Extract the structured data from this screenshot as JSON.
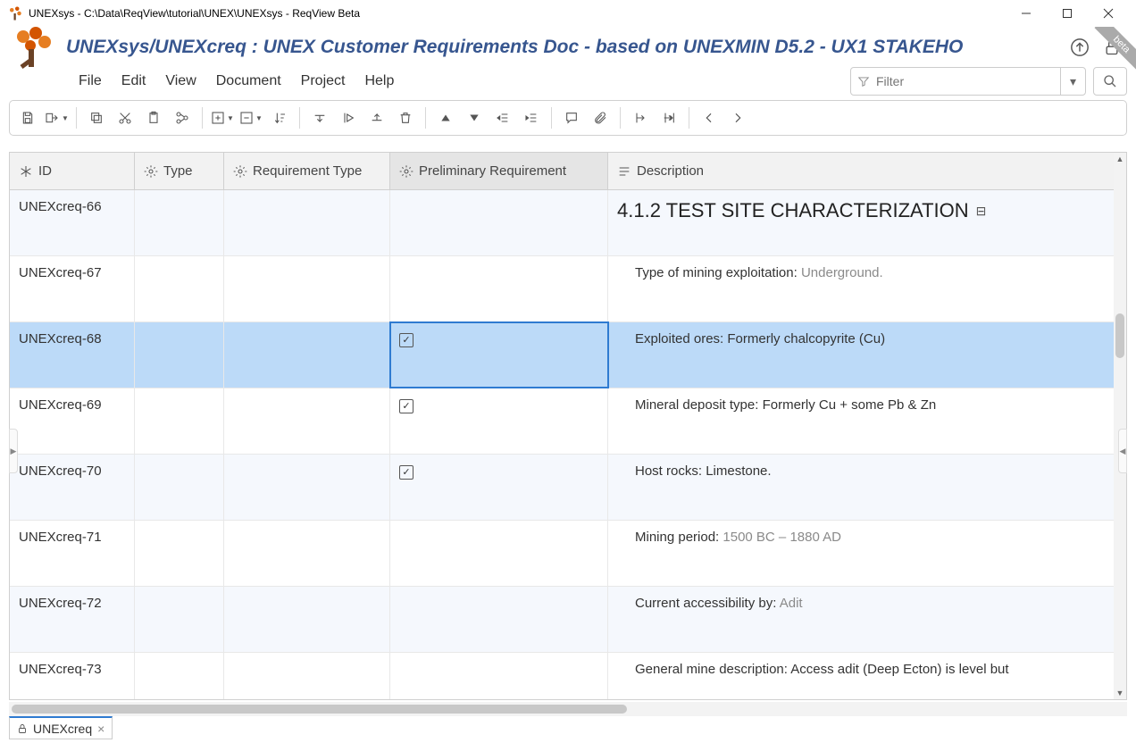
{
  "window": {
    "title": "UNEXsys - C:\\Data\\ReqView\\tutorial\\UNEX\\UNEXsys - ReqView Beta"
  },
  "header": {
    "breadcrumb": "UNEXsys/UNEXcreq : UNEX Customer Requirements Doc - based on UNEXMIN D5.2 - UX1 STAKEHO",
    "beta": "beta"
  },
  "menu": {
    "file": "File",
    "edit": "Edit",
    "view": "View",
    "document": "Document",
    "project": "Project",
    "help": "Help"
  },
  "filter": {
    "placeholder": "Filter"
  },
  "columns": {
    "id": "ID",
    "type": "Type",
    "reqtype": "Requirement Type",
    "prelim": "Preliminary Requirement",
    "desc": "Description"
  },
  "rows": [
    {
      "id": "UNEXcreq-66",
      "prelim": false,
      "heading": true,
      "desc_heading": "4.1.2 TEST SITE CHARACTERIZATION"
    },
    {
      "id": "UNEXcreq-67",
      "prelim": false,
      "desc_label": "Type of mining exploitation: ",
      "desc_value": "Underground."
    },
    {
      "id": "UNEXcreq-68",
      "prelim": true,
      "selected": true,
      "desc_label": "Exploited ores: ",
      "desc_plain": "Formerly chalcopyrite (Cu)"
    },
    {
      "id": "UNEXcreq-69",
      "prelim": true,
      "desc_label": "Mineral deposit type: ",
      "desc_plain": "Formerly Cu + some Pb & Zn"
    },
    {
      "id": "UNEXcreq-70",
      "prelim": true,
      "desc_label": "Host rocks: ",
      "desc_plain": "Limestone."
    },
    {
      "id": "UNEXcreq-71",
      "prelim": false,
      "desc_label": "Mining period: ",
      "desc_value": "1500 BC – 1880 AD"
    },
    {
      "id": "UNEXcreq-72",
      "prelim": false,
      "desc_label": "Current accessibility by: ",
      "desc_value": "Adit"
    },
    {
      "id": "UNEXcreq-73",
      "prelim": false,
      "desc_label": "General mine description: ",
      "desc_plain": "Access adit (Deep Ecton) is level but"
    }
  ],
  "tab": {
    "name": "UNEXcreq"
  }
}
